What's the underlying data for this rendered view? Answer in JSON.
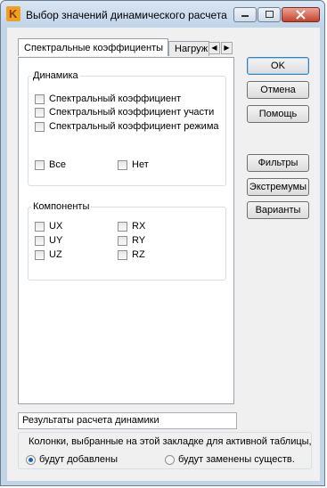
{
  "window": {
    "title": "Выбор значений динамического расчета"
  },
  "tabs": [
    "Спектральные коэффициенты",
    "Нагруж"
  ],
  "dynamics_group": {
    "legend": "Динамика",
    "items": [
      "Спектральный коэффициент",
      "Спектральный коэффициент участи",
      "Спектральный коэффициент режима"
    ],
    "all_label": "Все",
    "none_label": "Нет"
  },
  "components_group": {
    "legend": "Компоненты",
    "left": [
      "UX",
      "UY",
      "UZ"
    ],
    "right": [
      "RX",
      "RY",
      "RZ"
    ]
  },
  "buttons": {
    "ok": "OK",
    "cancel": "Отмена",
    "help": "Помощь",
    "filters": "Фильтры",
    "extremes": "Экстремумы",
    "variants": "Варианты"
  },
  "result_field": "Результаты расчета динамики",
  "columns_group": {
    "text": "Колонки, выбранные на этой закладке для активной таблицы,",
    "option_add": "будут добавлены",
    "option_replace": "будут заменены существ.",
    "selected": "будут добавлены"
  }
}
